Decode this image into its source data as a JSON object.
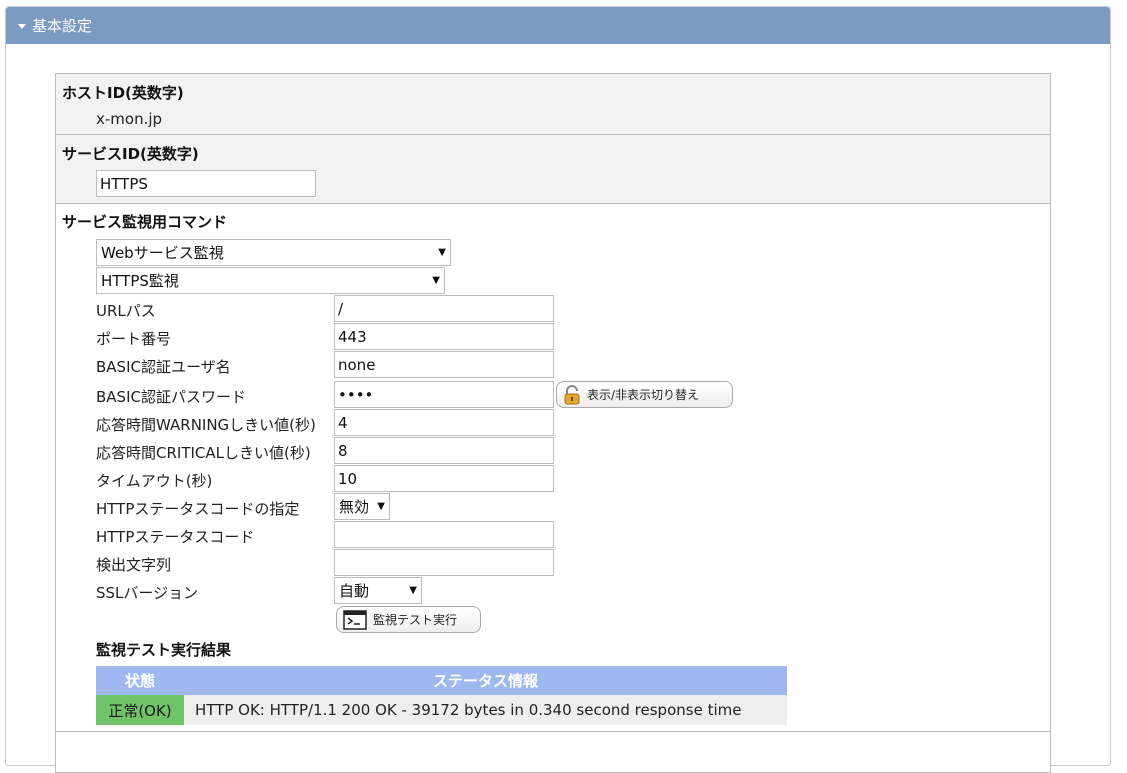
{
  "panel": {
    "title": "基本設定"
  },
  "host": {
    "label": "ホストID(英数字)",
    "value": "x-mon.jp"
  },
  "service": {
    "label": "サービスID(英数字)",
    "value": "HTTPS"
  },
  "command": {
    "label": "サービス監視用コマンド",
    "category_select": "Webサービス監視",
    "command_select": "HTTPS監視",
    "fields": {
      "url_path": {
        "label": "URLパス",
        "value": "/"
      },
      "port": {
        "label": "ポート番号",
        "value": "443"
      },
      "basic_user": {
        "label": "BASIC認証ユーザ名",
        "value": "none"
      },
      "basic_pass": {
        "label": "BASIC認証パスワード",
        "value": "••••"
      },
      "warning": {
        "label": "応答時間WARNINGしきい値(秒)",
        "value": "4"
      },
      "critical": {
        "label": "応答時間CRITICALしきい値(秒)",
        "value": "8"
      },
      "timeout": {
        "label": "タイムアウト(秒)",
        "value": "10"
      },
      "status_code_spec": {
        "label": "HTTPステータスコードの指定",
        "value": "無効"
      },
      "status_code": {
        "label": "HTTPステータスコード",
        "value": ""
      },
      "detect_string": {
        "label": "検出文字列",
        "value": ""
      },
      "ssl_version": {
        "label": "SSLバージョン",
        "value": "自動"
      }
    },
    "toggle_password_button": "表示/非表示切り替え",
    "run_test_button": "監視テスト実行"
  },
  "result": {
    "title": "監視テスト実行結果",
    "headers": {
      "status": "状態",
      "info": "ステータス情報"
    },
    "row": {
      "status": "正常(OK)",
      "info": "HTTP OK: HTTP/1.1 200 OK - 39172 bytes in 0.340 second response time"
    }
  },
  "colors": {
    "header_bar": "#7c9bc3",
    "section_bg": "#f2f2f2",
    "table_header": "#9fb9f0",
    "status_ok": "#72c46a"
  },
  "icons": {
    "lock": "lock-icon",
    "terminal": "terminal-icon",
    "caret": "caret-down-icon"
  }
}
